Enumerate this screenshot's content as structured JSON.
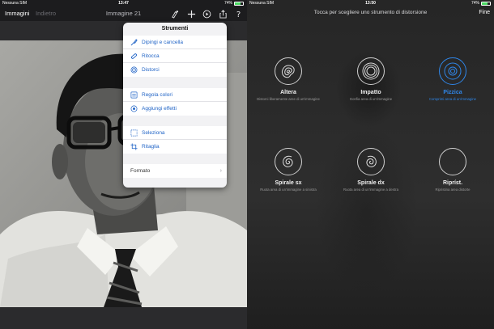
{
  "left": {
    "status": {
      "carrier": "Nessuna SIM",
      "time": "13:47",
      "battery": "74%"
    },
    "toolbar": {
      "images": "Immagini",
      "back": "Indietro",
      "title": "Immagine 21"
    },
    "popover": {
      "title": "Strumenti",
      "group1": [
        {
          "label": "Dipingi e cancella",
          "icon": "brush-icon"
        },
        {
          "label": "Ritocca",
          "icon": "bandage-icon"
        },
        {
          "label": "Distorci",
          "icon": "swirl-icon"
        }
      ],
      "group2": [
        {
          "label": "Regola colori",
          "icon": "sliders-icon"
        },
        {
          "label": "Aggiungi effetti",
          "icon": "effects-icon"
        }
      ],
      "group3": [
        {
          "label": "Seleziona",
          "icon": "select-icon"
        },
        {
          "label": "Ritaglia",
          "icon": "crop-icon"
        }
      ],
      "format": "Formato"
    }
  },
  "right": {
    "status": {
      "carrier": "Nessuna SIM",
      "time": "13:50",
      "battery": "74%"
    },
    "header": "Tocca per scegliere uno strumento di distorsione",
    "done": "Fine",
    "tools": [
      {
        "name": "Altera",
        "desc": "Distorci liberamente aree di un'immagine",
        "icon": "contour-icon"
      },
      {
        "name": "Impatto",
        "desc": "Gonfia area di un'immagine",
        "icon": "rings-icon"
      },
      {
        "name": "Pizzica",
        "desc": "Comprimi area di un'immagine",
        "icon": "pinch-icon"
      },
      {
        "name": "Spirale sx",
        "desc": "Ruota area di un'immagine a sinistra",
        "icon": "spiral-left-icon"
      },
      {
        "name": "Spirale dx",
        "desc": "Ruota area di un'immagine a destra",
        "icon": "spiral-right-icon"
      },
      {
        "name": "Ripríst.",
        "desc": "Ripristina area distorte",
        "icon": "restore-icon"
      }
    ],
    "accent": "#2f86e8"
  }
}
